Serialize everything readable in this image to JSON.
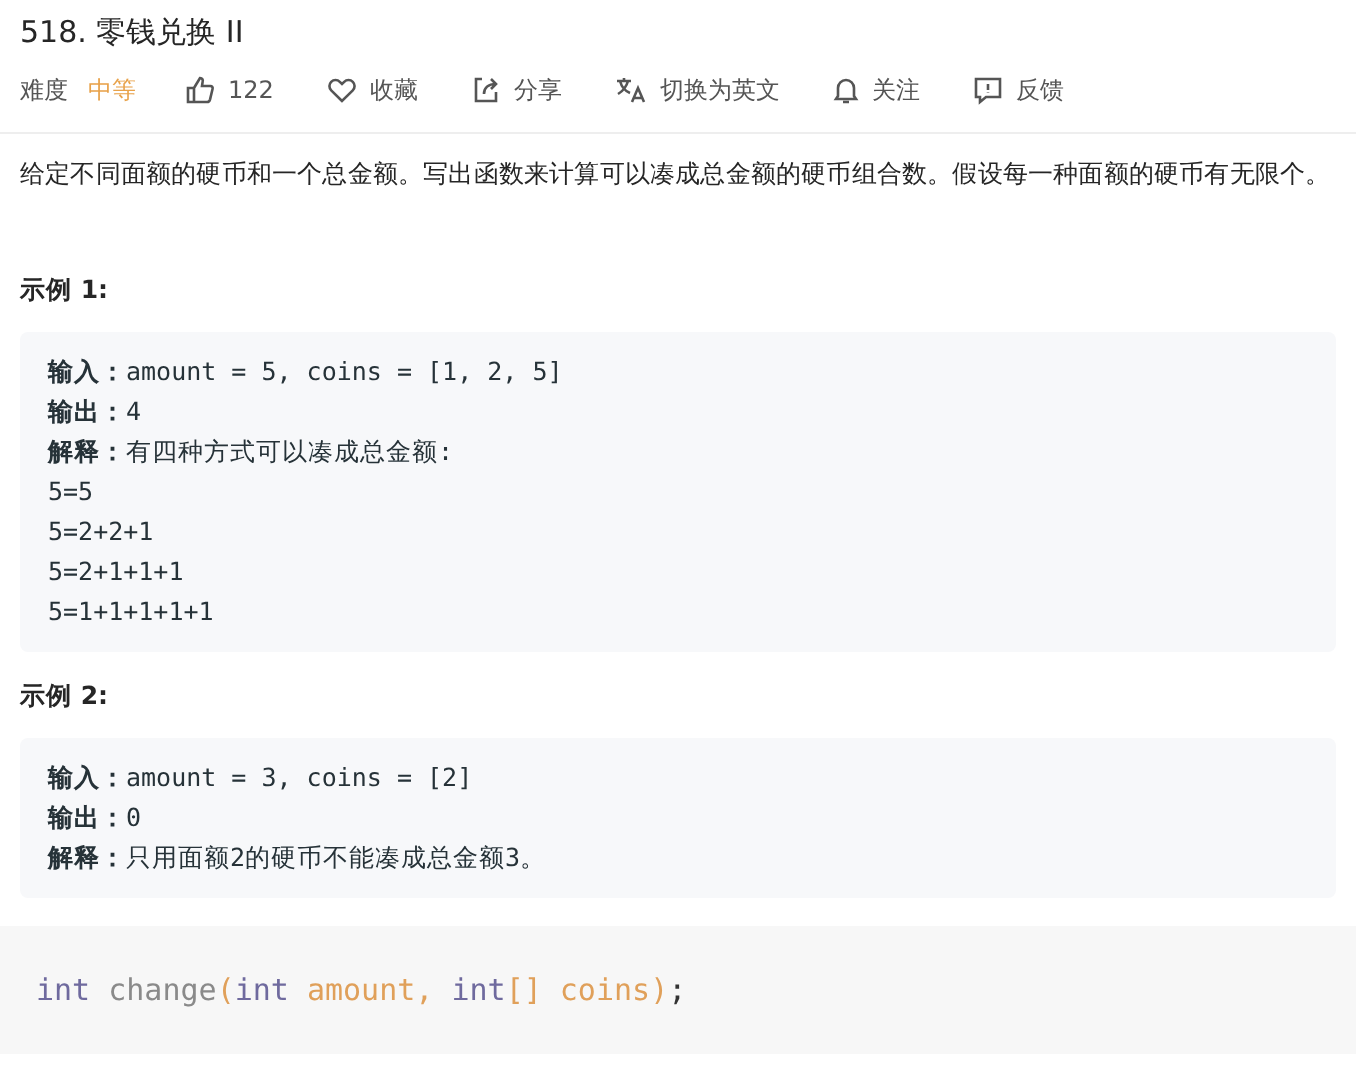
{
  "title": "518. 零钱兑换 II",
  "difficulty": {
    "label": "难度",
    "value": "中等",
    "kind": "medium"
  },
  "actions": [
    {
      "kind": "like",
      "label": "122"
    },
    {
      "kind": "favorite",
      "label": "收藏"
    },
    {
      "kind": "share",
      "label": "分享"
    },
    {
      "kind": "translate",
      "label": "切换为英文"
    },
    {
      "kind": "follow",
      "label": "关注"
    },
    {
      "kind": "feedback",
      "label": "反馈"
    }
  ],
  "description": "给定不同面额的硬币和一个总金额。写出函数来计算可以凑成总金额的硬币组合数。假设每一种面额的硬币有无限个。",
  "examples": [
    {
      "heading": "示例 1:",
      "lines": [
        {
          "label": "输入：",
          "value": "amount = 5, coins = [1, 2, 5]"
        },
        {
          "label": "输出：",
          "value": "4"
        },
        {
          "label": "解释：",
          "value": "有四种方式可以凑成总金额:"
        },
        {
          "value": "5=5"
        },
        {
          "value": "5=2+2+1"
        },
        {
          "value": "5=2+1+1+1"
        },
        {
          "value": "5=1+1+1+1+1"
        }
      ]
    },
    {
      "heading": "示例 2:",
      "lines": [
        {
          "label": "输入：",
          "value": "amount = 3, coins = [2]"
        },
        {
          "label": "输出：",
          "value": "0"
        },
        {
          "label": "解释：",
          "value": "只用面额2的硬币不能凑成总金额3。"
        }
      ]
    }
  ],
  "signature": [
    {
      "kind": "keyword",
      "text": "int "
    },
    {
      "kind": "function",
      "text": "change"
    },
    {
      "kind": "punct",
      "text": "("
    },
    {
      "kind": "keyword",
      "text": "int "
    },
    {
      "kind": "param",
      "text": "amount, "
    },
    {
      "kind": "keyword",
      "text": "int"
    },
    {
      "kind": "punct",
      "text": "[] "
    },
    {
      "kind": "param",
      "text": "coins"
    },
    {
      "kind": "punct",
      "text": ")"
    },
    {
      "kind": "end",
      "text": ";"
    }
  ]
}
